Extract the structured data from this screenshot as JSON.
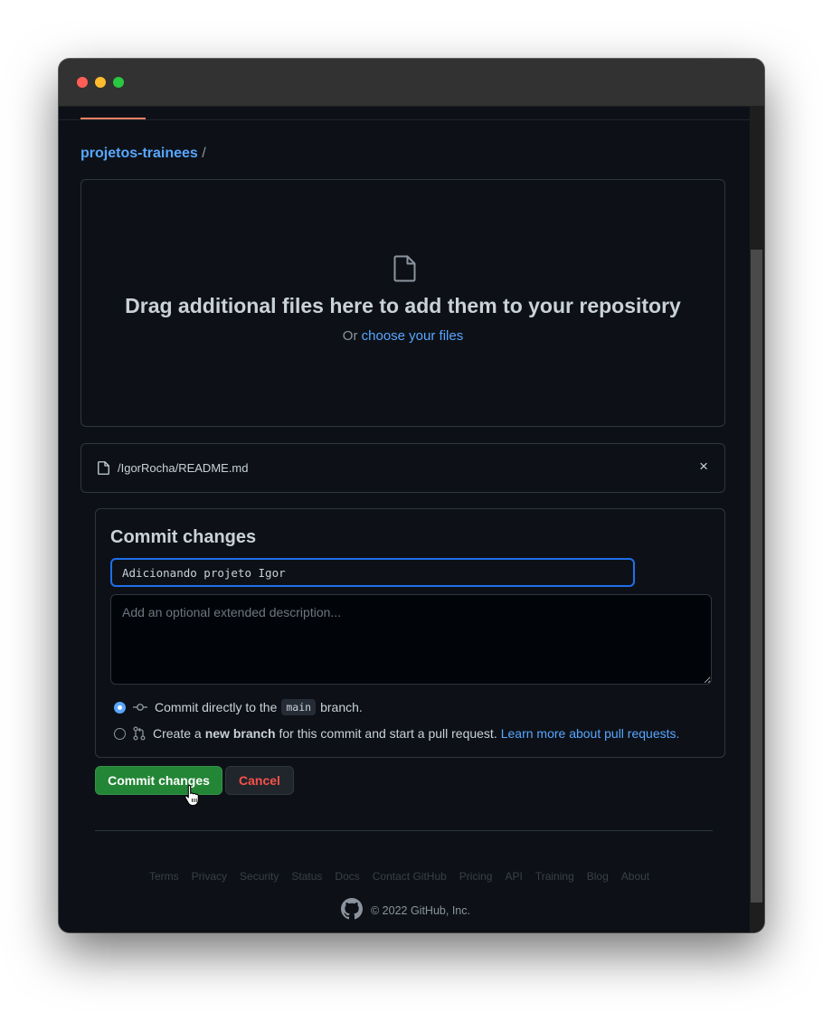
{
  "breadcrumb": {
    "repo": "projetos-trainees",
    "separator": "/"
  },
  "dropzone": {
    "title": "Drag additional files here to add them to your repository",
    "or_text": "Or",
    "choose_link": "choose your files"
  },
  "file": {
    "name": "/IgorRocha/README.md",
    "remove_label": "×"
  },
  "commit": {
    "title": "Commit changes",
    "summary_value": "Adicionando projeto Igor",
    "description_placeholder": "Add an optional extended description...",
    "option_direct": {
      "before": "Commit directly to the",
      "branch": "main",
      "after": "branch.",
      "selected": true
    },
    "option_new_branch": {
      "before": "Create a",
      "bold": "new branch",
      "after": "for this commit and start a pull request.",
      "link": "Learn more about pull requests.",
      "selected": false
    }
  },
  "buttons": {
    "commit": "Commit changes",
    "cancel": "Cancel"
  },
  "footer": {
    "links": [
      "Terms",
      "Privacy",
      "Security",
      "Status",
      "Docs",
      "Contact GitHub",
      "Pricing",
      "API",
      "Training",
      "Blog",
      "About"
    ],
    "copyright": "© 2022 GitHub, Inc."
  },
  "colors": {
    "background": "#0d1117",
    "link": "#58a6ff",
    "commit_button": "#238636",
    "cancel_text": "#f85149",
    "focus_border": "#1f6feb"
  }
}
